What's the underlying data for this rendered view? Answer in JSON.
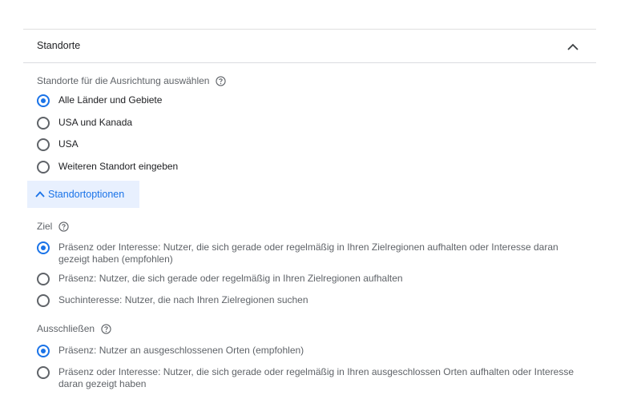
{
  "section": {
    "title": "Standorte"
  },
  "targeting": {
    "label": "Standorte für die Ausrichtung auswählen",
    "options": [
      {
        "label": "Alle Länder und Gebiete",
        "checked": true
      },
      {
        "label": "USA und Kanada",
        "checked": false
      },
      {
        "label": "USA",
        "checked": false
      },
      {
        "label": "Weiteren Standort eingeben",
        "checked": false
      }
    ]
  },
  "location_options": {
    "toggle_label": "Standortoptionen"
  },
  "goal": {
    "label": "Ziel",
    "options": [
      {
        "label": "Präsenz oder Interesse: Nutzer, die sich gerade oder regelmäßig in Ihren Zielregionen aufhalten oder Interesse daran gezeigt haben (empfohlen)",
        "checked": true
      },
      {
        "label": "Präsenz: Nutzer, die sich gerade oder regelmäßig in Ihren Zielregionen aufhalten",
        "checked": false
      },
      {
        "label": "Suchinteresse: Nutzer, die nach Ihren Zielregionen suchen",
        "checked": false
      }
    ]
  },
  "exclude": {
    "label": "Ausschließen",
    "options": [
      {
        "label": "Präsenz: Nutzer an ausgeschlossenen Orten (empfohlen)",
        "checked": true
      },
      {
        "label": "Präsenz oder Interesse: Nutzer, die sich gerade oder regelmäßig in Ihren ausgeschlossen Orten aufhalten oder Interesse daran gezeigt haben",
        "checked": false
      }
    ]
  },
  "colors": {
    "accent": "#1a73e8",
    "toggle_bg": "#e8f0fe",
    "divider": "#dadce0"
  },
  "icons": {
    "collapse": "chevron-up-icon",
    "help": "help-circle-icon",
    "options_toggle": "chevron-up-icon"
  }
}
